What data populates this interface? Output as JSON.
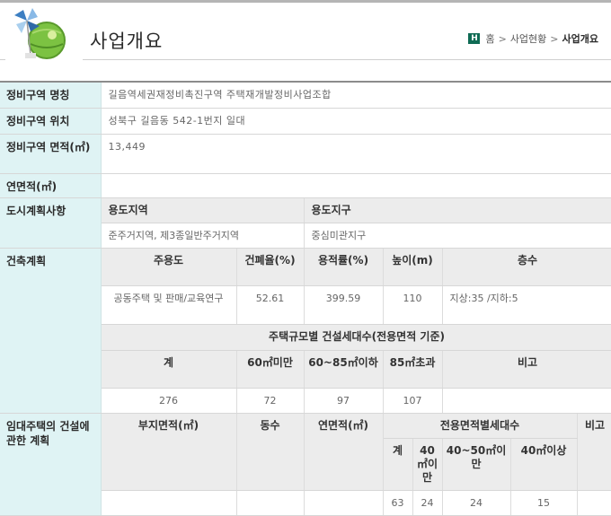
{
  "header": {
    "title": "사업개요",
    "breadcrumb": {
      "home_icon": "H",
      "home": "홈",
      "parent": "사업현황",
      "current": "사업개요",
      "separator": ">"
    }
  },
  "info": {
    "name_label": "정비구역 명칭",
    "name_value": "길음역세권재정비촉진구역 주택재개발정비사업조합",
    "location_label": "정비구역 위치",
    "location_value": "성북구 길음동 542-1번지 일대",
    "area_label": "정비구역 면적(㎡)",
    "area_value": "13,449",
    "floor_area_label": "연면적(㎡)",
    "floor_area_value": "",
    "urban_plan": {
      "label": "도시계획사항",
      "zone_header": "용도지역",
      "district_header": "용도지구",
      "zone_value": "준주거지역, 제3종일반주거지역",
      "district_value": "중심미관지구"
    },
    "building_plan": {
      "label": "건축계획",
      "headers": {
        "main_use": "주용도",
        "coverage": "건폐율(%)",
        "far": "용적률(%)",
        "height": "높이(m)",
        "floors": "층수"
      },
      "values": {
        "main_use": "공동주택 및 판매/교육연구",
        "coverage": "52.61",
        "far": "399.59",
        "height": "110",
        "floors": "지상:35 /지하:5"
      },
      "units_title": "주택규모별 건설세대수(전용면적 기준)",
      "unit_headers": {
        "total": "계",
        "under60": "60㎡미만",
        "mid": "60~85㎡이하",
        "over85": "85㎡초과",
        "note": "비고"
      },
      "unit_values": {
        "total": "276",
        "under60": "72",
        "mid": "97",
        "over85": "107",
        "note": ""
      }
    },
    "rental_plan": {
      "label": "임대주택의 건설에 관한 계획",
      "headers": {
        "site_area": "부지면적(㎡)",
        "buildings": "동수",
        "floor_area": "연면적(㎡)",
        "by_area_title": "전용면적별세대수",
        "note": "비고"
      },
      "sub_headers": {
        "total": "계",
        "under40": "40㎡이만",
        "mid": "40~50㎡이만",
        "over40": "40㎡이상"
      },
      "values": {
        "site_area": "",
        "buildings": "",
        "floor_area": "",
        "total": "63",
        "under40": "24",
        "mid": "24",
        "over40": "15",
        "note": ""
      }
    }
  }
}
